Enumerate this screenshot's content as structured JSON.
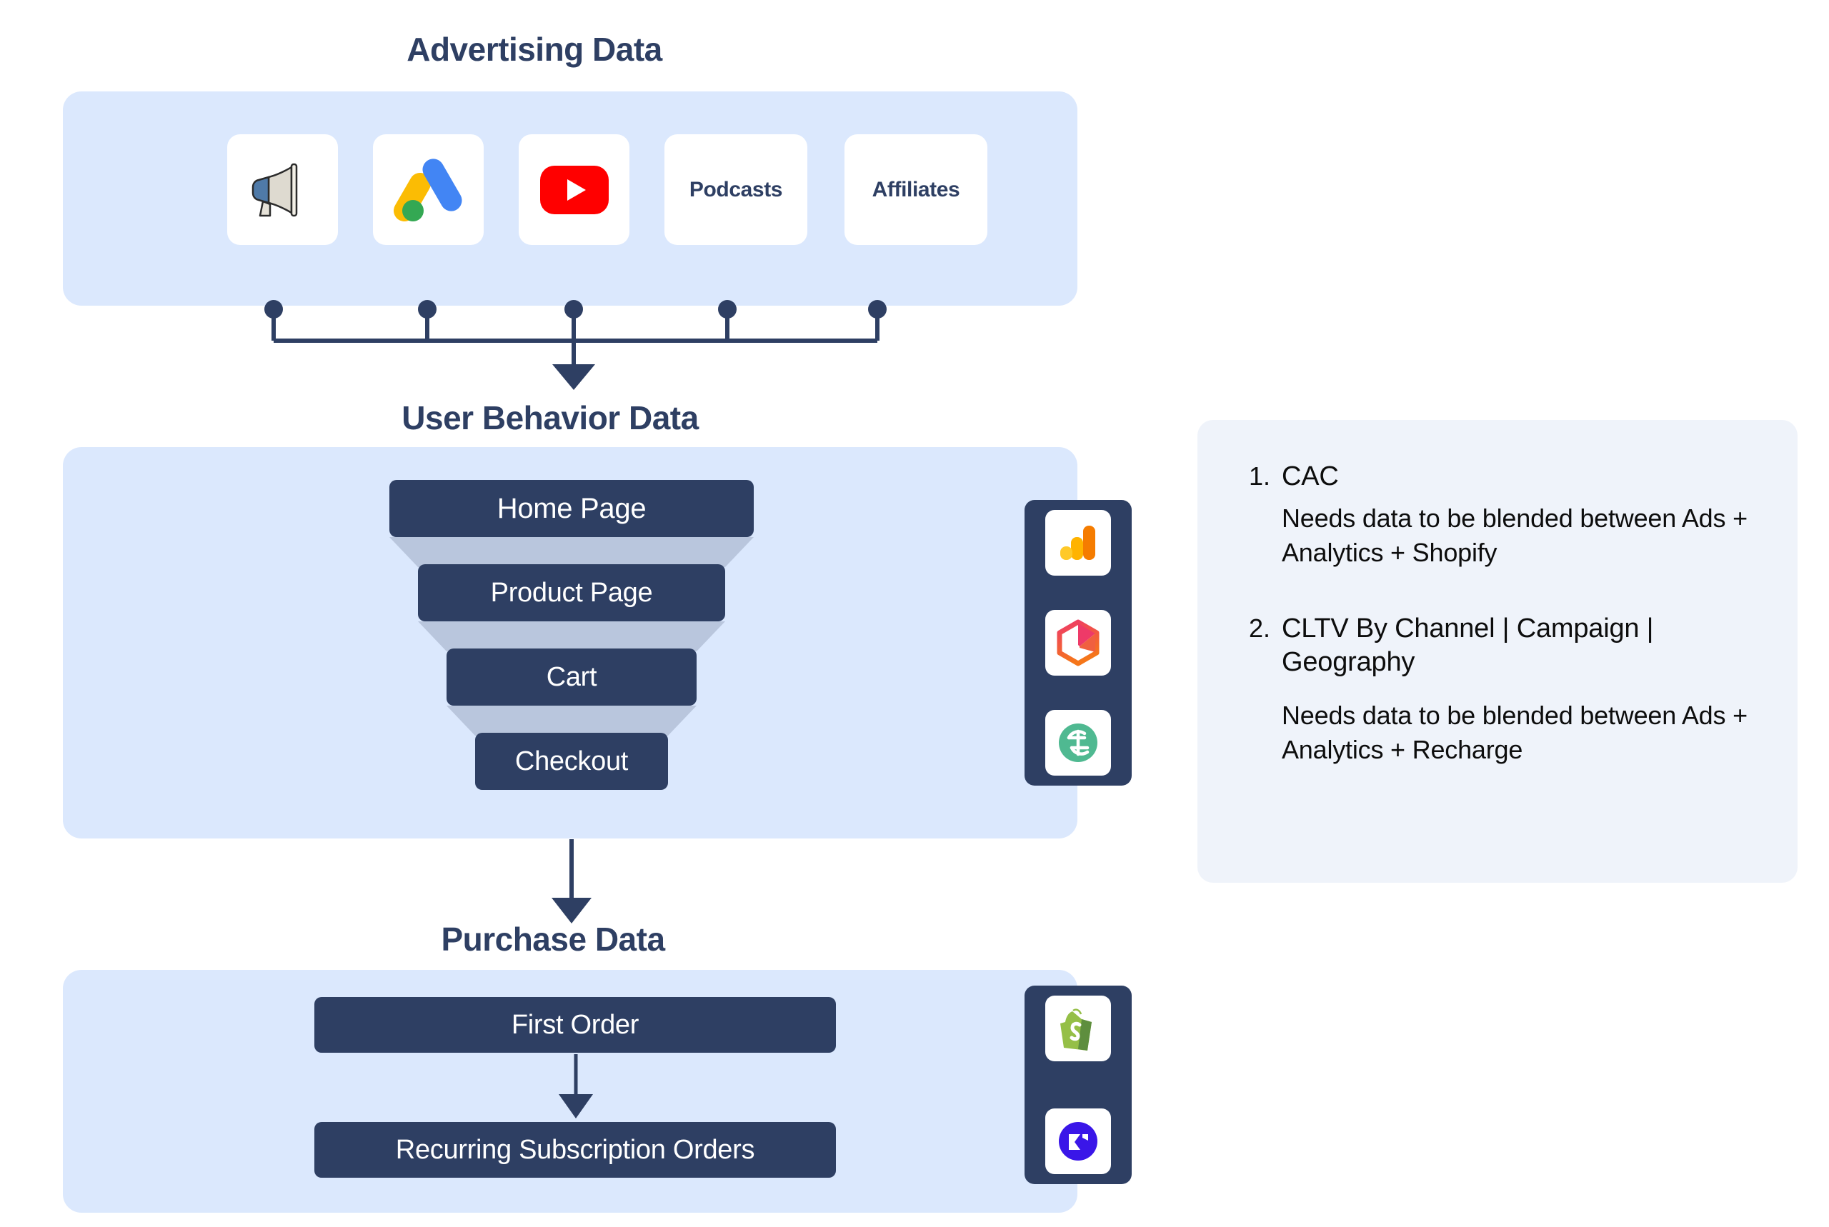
{
  "colors": {
    "panel_bg": "#dbe8fd",
    "dark_navy": "#2e3f63",
    "taper": "#b9c6dd",
    "info_bg": "#eff3fa",
    "card_white": "#ffffff",
    "page_bg": "#ffffff"
  },
  "advertising": {
    "title": "Advertising Data",
    "sources": [
      {
        "label": "",
        "icon": "megaphone-icon"
      },
      {
        "label": "",
        "icon": "google-ads-icon"
      },
      {
        "label": "",
        "icon": "youtube-icon"
      },
      {
        "label": "Podcasts",
        "icon": "text-only"
      },
      {
        "label": "Affiliates",
        "icon": "text-only"
      }
    ]
  },
  "user_behavior": {
    "title": "User Behavior Data",
    "funnel_stages": [
      {
        "label": "Home Page"
      },
      {
        "label": "Product Page"
      },
      {
        "label": "Cart"
      },
      {
        "label": "Checkout"
      }
    ],
    "tools": [
      {
        "icon": "google-analytics-icon"
      },
      {
        "icon": "glew-hexagon-icon"
      },
      {
        "icon": "segment-icon"
      }
    ]
  },
  "purchase": {
    "title": "Purchase Data",
    "steps": [
      {
        "label": "First Order"
      },
      {
        "label": "Recurring Subscription Orders"
      }
    ],
    "tools": [
      {
        "icon": "shopify-icon"
      },
      {
        "icon": "recharge-icon"
      }
    ]
  },
  "metrics_panel": {
    "items": [
      {
        "number": "1.",
        "heading": "CAC",
        "description": "Needs data to be blended between Ads + Analytics + Shopify"
      },
      {
        "number": "2.",
        "heading": "CLTV By Channel | Campaign | Geography",
        "description": "Needs data to be blended between Ads + Analytics + Recharge"
      }
    ]
  }
}
